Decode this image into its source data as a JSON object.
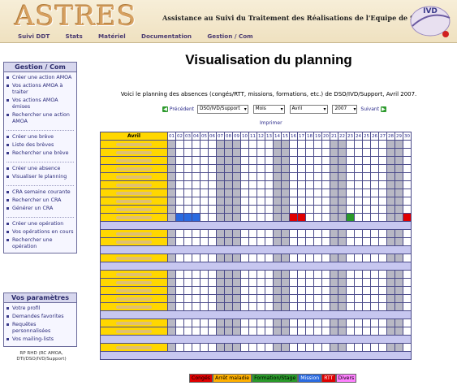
{
  "header": {
    "logo": "ASTRES",
    "subtitle": "Assistance au Suivi du Traitement des Réalisations de l'Equipe de Support",
    "badge": "IVD",
    "nav": [
      "Suivi DDT",
      "Stats",
      "Matériel",
      "Documentation",
      "Gestion / Com"
    ]
  },
  "sidebar": {
    "gestion_title": "Gestion / Com",
    "gestion_items": [
      "Créer une action AMOA",
      "Vos actions AMOA à traiter",
      "Vos actions AMOA émises",
      "Rechercher une action AMOA",
      "Créer une brève",
      "Liste des brèves",
      "Rechercher une brève",
      "Créer une absence",
      "Visualiser le planning",
      "CRA semaine courante",
      "Rechercher un CRA",
      "Générer un CRA",
      "Créer une opération",
      "Vos opérations en cours",
      "Rechercher une opération"
    ],
    "params_title": "Vos paramètres",
    "params_items": [
      "Votre profil",
      "Demandes favorites",
      "Requêtes personnalisées",
      "Vos mailing-lists"
    ],
    "footnote": "RP RHD (RC AMOA, DTI/DSO/IVD/Support)"
  },
  "main": {
    "title": "Visualisation du planning",
    "intro": "Voici le planning des absences (congés/RTT, missions, formations, etc.) de DSO/IVD/Support, Avril 2007.",
    "prev_label": "Précédent",
    "next_label": "Suivant",
    "group_select": "DSO/IVD/Support",
    "period_select": "Mois",
    "month_select": "Avril",
    "year_select": "2007",
    "print_label": "Imprimer"
  },
  "planning": {
    "month_label": "Avril",
    "days": [
      "01",
      "02",
      "03",
      "04",
      "05",
      "06",
      "07",
      "08",
      "09",
      "10",
      "11",
      "12",
      "13",
      "14",
      "15",
      "16",
      "17",
      "18",
      "19",
      "20",
      "21",
      "22",
      "23",
      "24",
      "25",
      "26",
      "27",
      "28",
      "29",
      "30"
    ],
    "weekend_days": [
      1,
      7,
      8,
      9,
      14,
      15,
      21,
      22,
      28,
      29
    ],
    "rows": [
      {
        "type": "person",
        "marks": {}
      },
      {
        "type": "person",
        "marks": {}
      },
      {
        "type": "person",
        "marks": {}
      },
      {
        "type": "person",
        "marks": {}
      },
      {
        "type": "person",
        "marks": {}
      },
      {
        "type": "person",
        "marks": {}
      },
      {
        "type": "person",
        "marks": {}
      },
      {
        "type": "person",
        "marks": {}
      },
      {
        "type": "person",
        "marks": {}
      },
      {
        "type": "person",
        "marks": {
          "2": "blue",
          "3": "blue",
          "4": "blue",
          "16": "red",
          "17": "red",
          "23": "green",
          "30": "red"
        }
      },
      {
        "type": "sep"
      },
      {
        "type": "person",
        "marks": {}
      },
      {
        "type": "person",
        "marks": {}
      },
      {
        "type": "sep"
      },
      {
        "type": "person",
        "marks": {}
      },
      {
        "type": "sep"
      },
      {
        "type": "person",
        "marks": {}
      },
      {
        "type": "person",
        "marks": {}
      },
      {
        "type": "person",
        "marks": {}
      },
      {
        "type": "person",
        "marks": {}
      },
      {
        "type": "person",
        "marks": {}
      },
      {
        "type": "sep"
      },
      {
        "type": "person",
        "marks": {}
      },
      {
        "type": "person",
        "marks": {}
      },
      {
        "type": "sep"
      },
      {
        "type": "person",
        "marks": {}
      },
      {
        "type": "sep"
      }
    ]
  },
  "legend": [
    {
      "label": "Congés",
      "bg": "#e00000",
      "fg": "#000000"
    },
    {
      "label": "Arrêt maladie",
      "bg": "#ffb000",
      "fg": "#000000"
    },
    {
      "label": "Formation/Stage",
      "bg": "#2a9a2a",
      "fg": "#000000"
    },
    {
      "label": "Mission",
      "bg": "#2a6ae0",
      "fg": "#ffffff"
    },
    {
      "label": "RTT",
      "bg": "#e00000",
      "fg": "#ffffff"
    },
    {
      "label": "Divers",
      "bg": "#ff80ff",
      "fg": "#000000"
    }
  ]
}
